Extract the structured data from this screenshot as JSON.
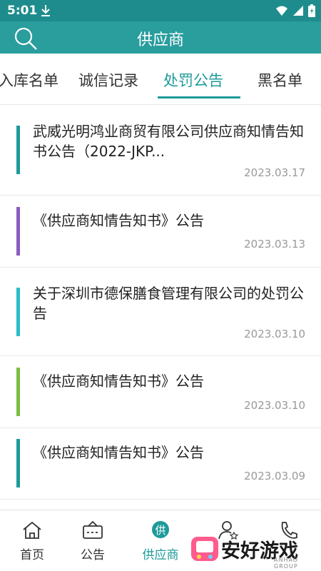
{
  "status_bar": {
    "time": "5:01"
  },
  "header": {
    "title": "供应商"
  },
  "tabs": [
    {
      "label": "入库名单"
    },
    {
      "label": "诚信记录"
    },
    {
      "label": "处罚公告"
    },
    {
      "label": "黑名单"
    }
  ],
  "active_tab": "处罚公告",
  "items": [
    {
      "title": "武威光明鸿业商贸有限公司供应商知情告知书公告（2022-JKP...",
      "date": "2023.03.17",
      "accent_color": "#1f9a9a"
    },
    {
      "title": "《供应商知情告知书》公告",
      "date": "2023.03.13",
      "accent_color": "#8a5cc0"
    },
    {
      "title": "关于深圳市德保膳食管理有限公司的处罚公告",
      "date": "2023.03.10",
      "accent_color": "#2bbcc8"
    },
    {
      "title": "《供应商知情告知书》公告",
      "date": "2023.03.10",
      "accent_color": "#7cbd44"
    },
    {
      "title": "《供应商知情告知书》公告",
      "date": "2023.03.09",
      "accent_color": "#1f9a9a"
    }
  ],
  "bottom_nav": [
    {
      "label": "首页",
      "icon": "home-icon"
    },
    {
      "label": "公告",
      "icon": "announcement-icon"
    },
    {
      "label": "供应商",
      "icon": "supplier-icon",
      "badge": "供"
    },
    {
      "label": "",
      "icon": "user-star-icon"
    },
    {
      "label": "",
      "icon": "phone-icon"
    }
  ],
  "watermark": {
    "text": "安好游戏",
    "sub": "ANHAO GROUP"
  },
  "colors": {
    "primary": "#2a9d9d",
    "status_bar": "#1e8c8c",
    "active": "#1e9a9a"
  }
}
